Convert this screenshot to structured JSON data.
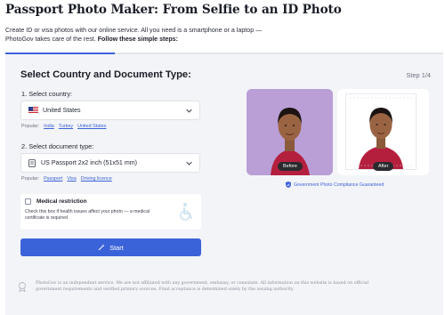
{
  "header": {
    "title": "Passport Photo Maker: From Selfie to an ID Photo",
    "intro": "Create ID or visa photos with our online service. All you need is a smartphone or a laptop — PhotoGov takes care of the rest.",
    "intro_bold": "Follow these simple steps:"
  },
  "wizard": {
    "section_title": "Select Country and Document Type:",
    "step_label": "Step 1/4",
    "progress_fraction": 0.25,
    "country": {
      "label": "1. Select country:",
      "value": "United States",
      "flag_icon": "us-flag-icon",
      "popular_label": "Popular:",
      "popular": [
        "India",
        "Turkey",
        "United States"
      ]
    },
    "document": {
      "label": "2. Select document type:",
      "value": "US Passport 2x2 inch (51x51 mm)",
      "popular_label": "Popular:",
      "popular": [
        "Passport",
        "Visa",
        "Driving licence"
      ]
    },
    "medical": {
      "title": "Medical restriction",
      "description": "Check this box if health issues affect your photo — a medical certificate is required",
      "checked": false,
      "icon": "wheelchair-icon"
    },
    "start_button": {
      "label": "Start",
      "icon": "magic-wand-icon"
    }
  },
  "preview": {
    "before_label": "Before",
    "after_label": "After",
    "guarantee": "Government Photo Compliance Guaranteed",
    "guarantee_icon": "shield-check-icon",
    "before_bg_color": "#ba9fd7"
  },
  "footer": {
    "disclaimer": "PhotoGov is an independent service. We are not affiliated with any government, embassy, or consulate. All information on this website is based on official government requirements and verified primary sources. Final acceptance is determined solely by the issuing authority.",
    "icon": "certificate-badge-icon"
  },
  "colors": {
    "accent": "#3b63d9",
    "panel_bg": "#f3f4f7",
    "text": "#1a1d26"
  }
}
